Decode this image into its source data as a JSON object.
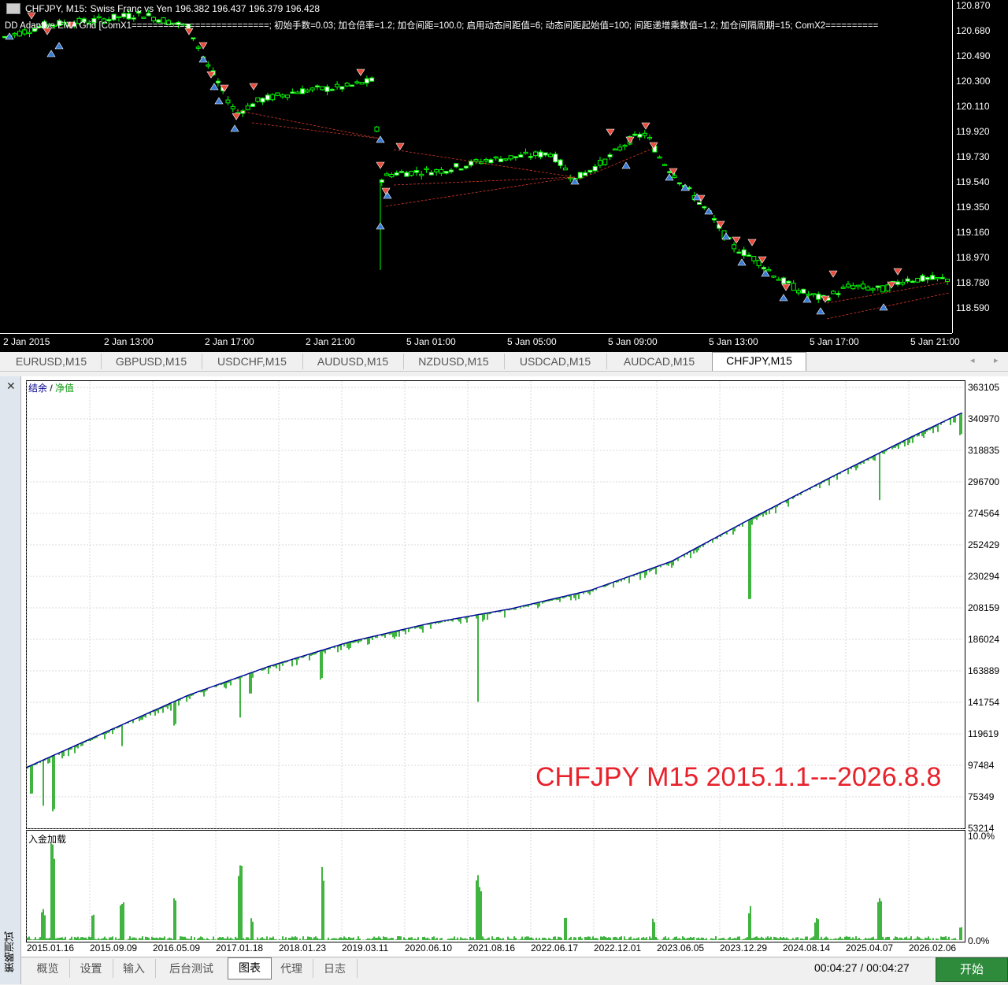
{
  "price_chart": {
    "symbol": "CHFJPY, M15:",
    "description": "Swiss Franc vs Yen",
    "ohlc": "196.382 196.437 196.379 196.428",
    "indicator_line": "DD Adaptive EMA Grid [ComX1==========================; 初始手数=0.03; 加仓倍率=1.2; 加仓间距=100.0; 启用动态间距值=6; 动态间距起始值=100; 间距递增乘数值=1.2; 加仓间隔周期=15; ComX2==========",
    "y_labels": [
      "120.870",
      "120.680",
      "120.490",
      "120.300",
      "120.110",
      "119.920",
      "119.730",
      "119.540",
      "119.350",
      "119.160",
      "118.970",
      "118.780",
      "118.590"
    ],
    "x_labels": [
      "2 Jan 2015",
      "2 Jan 13:00",
      "2 Jan 17:00",
      "2 Jan 21:00",
      "5 Jan 01:00",
      "5 Jan 05:00",
      "5 Jan 09:00",
      "5 Jan 13:00",
      "5 Jan 17:00",
      "5 Jan 21:00"
    ],
    "colors": {
      "bull": "#ffffff",
      "bear": "#000000",
      "wick": "#00ff00",
      "sell_arrow": "#e74c3c",
      "buy_arrow": "#3a7bd5",
      "link": "#d93a2b"
    }
  },
  "symbol_tabs": [
    "EURUSD,M15",
    "GBPUSD,M15",
    "USDCHF,M15",
    "AUDUSD,M15",
    "NZDUSD,M15",
    "USDCAD,M15",
    "AUDCAD,M15",
    "CHFJPY,M15"
  ],
  "active_symbol_tab": "CHFJPY,M15",
  "side_label": "策略测试",
  "equity": {
    "legend_balance": "结余",
    "legend_sep": " / ",
    "legend_equity": "净值",
    "y_labels": [
      "363105",
      "340970",
      "318835",
      "296700",
      "274564",
      "252429",
      "230294",
      "208159",
      "186024",
      "163889",
      "141754",
      "119619",
      "97484",
      "75349",
      "53214"
    ],
    "overlay_text": "CHFJPY M15 2015.1.1---2026.8.8"
  },
  "deposit": {
    "label": "入金加载",
    "y_top": "10.0%",
    "y_bottom": "0.0%"
  },
  "chart_data": [
    {
      "type": "line",
      "title": "",
      "series": [
        {
          "name": "结余",
          "x": [
            "2015.01.01",
            "2016.01.01",
            "2017.01.01",
            "2018.01.01",
            "2019.01.01",
            "2020.01.01",
            "2021.01.01",
            "2022.01.01",
            "2023.01.01",
            "2024.01.01",
            "2025.01.01",
            "2026.01.01",
            "2026.08.08"
          ],
          "values": [
            95000,
            120000,
            145000,
            165000,
            182000,
            195000,
            205000,
            218000,
            238000,
            268000,
            297000,
            325000,
            340970
          ]
        }
      ],
      "x_tick_labels": [
        "2015.01.16",
        "2015.09.09",
        "2016.05.09",
        "2017.01.18",
        "2018.01.23",
        "2019.03.11",
        "2020.06.10",
        "2021.08.16",
        "2022.06.17",
        "2022.12.01",
        "2023.06.05",
        "2023.12.29",
        "2024.08.14",
        "2025.04.07",
        "2026.02.06"
      ],
      "ylim": [
        53214,
        363105
      ],
      "grid": true
    },
    {
      "type": "bar",
      "title": "",
      "ylim": [
        0,
        10
      ],
      "y_unit": "%"
    }
  ],
  "bottom_tabs": [
    "概览",
    "设置",
    "输入",
    "后台测试",
    "图表",
    "代理",
    "日志"
  ],
  "active_bottom_tab": "图表",
  "timer": "00:04:27 / 00:04:27",
  "start_button": "开始"
}
